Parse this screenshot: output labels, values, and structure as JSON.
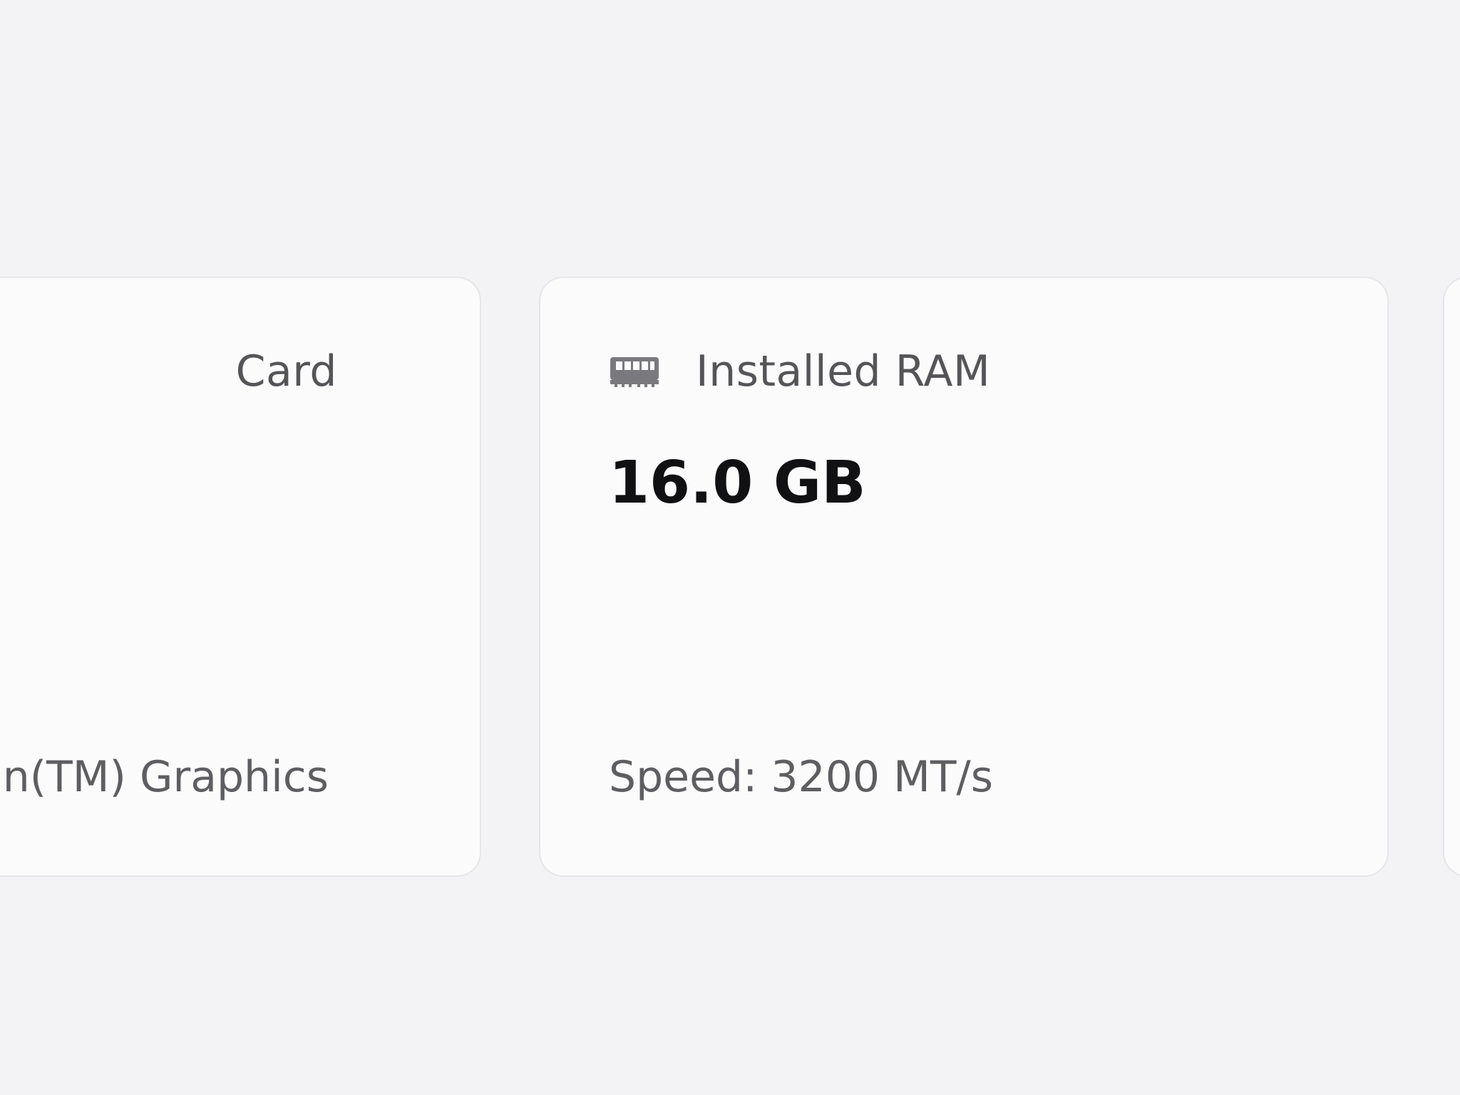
{
  "cards": {
    "left": {
      "title": "Card",
      "footer": "n(TM) Graphics"
    },
    "ram": {
      "icon": "ram-icon",
      "title": "Installed RAM",
      "value": "16.0 GB",
      "footer": "Speed: 3200 MT/s"
    }
  }
}
